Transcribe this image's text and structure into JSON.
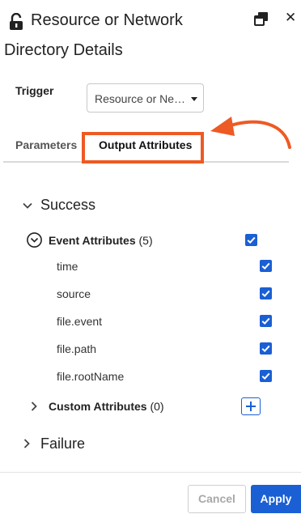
{
  "header": {
    "title_line1": "Resource or Network",
    "title_line2": "Directory Details",
    "lock_icon": "unlock-icon",
    "copy_icon": "copy-window-icon",
    "close_label": "✕"
  },
  "trigger": {
    "label": "Trigger",
    "selected": "Resource or Ne…"
  },
  "tabs": [
    {
      "label": "Parameters",
      "active": false
    },
    {
      "label": "Output Attributes",
      "active": true
    }
  ],
  "colors": {
    "accent": "#1a5fd4",
    "annotation": "#ee5a24"
  },
  "success": {
    "label": "Success",
    "event_attributes": {
      "label": "Event Attributes",
      "count": "(5)",
      "checked": true,
      "items": [
        {
          "label": "time",
          "checked": true
        },
        {
          "label": "source",
          "checked": true
        },
        {
          "label": "file.event",
          "checked": true
        },
        {
          "label": "file.path",
          "checked": true
        },
        {
          "label": "file.rootName",
          "checked": true
        }
      ]
    },
    "custom_attributes": {
      "label": "Custom Attributes",
      "count": "(0)"
    }
  },
  "failure": {
    "label": "Failure"
  },
  "footer": {
    "cancel_label": "Cancel",
    "apply_label": "Apply"
  }
}
